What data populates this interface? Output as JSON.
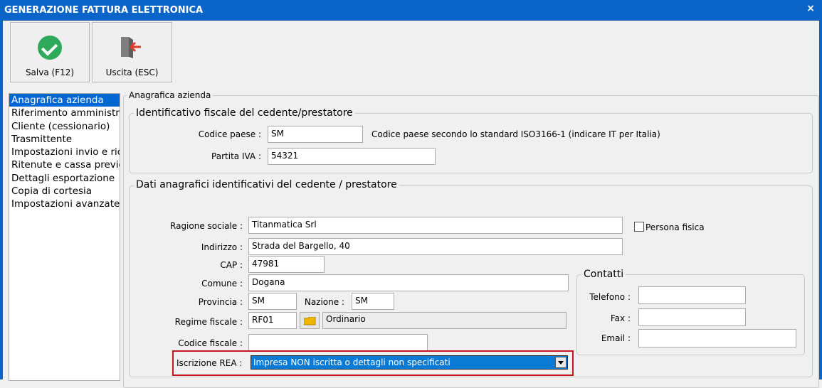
{
  "window": {
    "title": "GENERAZIONE FATTURA ELETTRONICA",
    "close_glyph": "×"
  },
  "toolbar": {
    "save_label": "Salva (F12)",
    "save_icon": "check-circle-icon",
    "exit_label": "Uscita (ESC)",
    "exit_icon": "exit-door-icon"
  },
  "nav": {
    "items": [
      "Anagrafica azienda",
      "Riferimento amministra",
      "Cliente (cessionario)",
      "Trasmittente",
      "Impostazioni invio e ric",
      "Ritenute e cassa previc",
      "Dettagli esportazione",
      "Copia di cortesia",
      "Impostazioni avanzate"
    ],
    "selected_index": 0
  },
  "panel": {
    "title": "Anagrafica azienda"
  },
  "fiscal": {
    "legend": "Identificativo fiscale del cedente/prestatore",
    "country_label": "Codice paese :",
    "country_value": "SM",
    "country_hint": "Codice paese secondo lo standard ISO3166-1 (indicare IT per Italia)",
    "vat_label": "Partita IVA :",
    "vat_value": "54321"
  },
  "registry": {
    "legend": "Dati anagrafici identificativi del cedente / prestatore",
    "ragione_label": "Ragione sociale :",
    "ragione_value": "Titanmatica Srl",
    "persona_label": "Persona fisica",
    "persona_checked": false,
    "indirizzo_label": "Indirizzo :",
    "indirizzo_value": "Strada del Bargello, 40",
    "cap_label": "CAP :",
    "cap_value": "47981",
    "comune_label": "Comune :",
    "comune_value": "Dogana",
    "provincia_label": "Provincia :",
    "provincia_value": "SM",
    "nazione_label": "Nazione :",
    "nazione_value": "SM",
    "regime_label": "Regime fiscale :",
    "regime_code": "RF01",
    "regime_desc": "Ordinario",
    "regime_lookup_icon": "folder-icon",
    "cf_label": "Codice fiscale :",
    "cf_value": "",
    "rea_label": "Iscrizione REA :",
    "rea_value": "Impresa NON iscritta o dettagli non specificati"
  },
  "contacts": {
    "legend": "Contatti",
    "tel_label": "Telefono :",
    "tel_value": "",
    "fax_label": "Fax :",
    "fax_value": "",
    "email_label": "Email :",
    "email_value": ""
  },
  "colors": {
    "titlebar": "#0b64c8",
    "selection": "#0066d2",
    "highlight": "#c8141e",
    "check": "#2faa5a",
    "exit_arrow": "#e03c28"
  }
}
